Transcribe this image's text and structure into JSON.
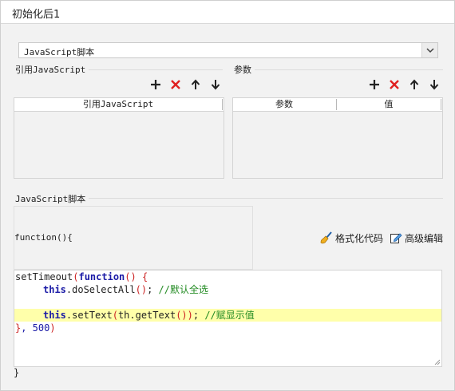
{
  "window": {
    "title": "初始化后1"
  },
  "script_type": {
    "value": "JavaScript脚本"
  },
  "ref_js": {
    "legend": "引用JavaScript",
    "column": "引用JavaScript"
  },
  "params": {
    "legend": "参数",
    "columns": [
      "参数",
      "值"
    ]
  },
  "script": {
    "legend": "JavaScript脚本",
    "function_header": "function(){",
    "format_label": "格式化代码",
    "advanced_label": "高级编辑",
    "closing": "}"
  },
  "code": {
    "l1_a": "setTimeout",
    "l1_b": "(",
    "l1_c": "function",
    "l1_d": "() {",
    "l2_a": "this",
    "l2_b": ".doSelectAll",
    "l2_c": "()",
    "l2_d": "; ",
    "l2_e": "//默认全选",
    "l4_a": "this",
    "l4_b": ".setText",
    "l4_c": "(",
    "l4_d": "th.getText",
    "l4_e": "())",
    "l4_f": "; ",
    "l4_g": "//赋显示值",
    "l5_a": "}",
    "l5_b": ", 500",
    "l5_c": ")"
  },
  "icons": {
    "add": "plus-icon",
    "delete": "x-icon",
    "up": "arrow-up-icon",
    "down": "arrow-down-icon",
    "format": "broom-icon",
    "edit": "edit-icon"
  },
  "colors": {
    "delete_red": "#e02020",
    "highlight": "#ffffaa"
  }
}
